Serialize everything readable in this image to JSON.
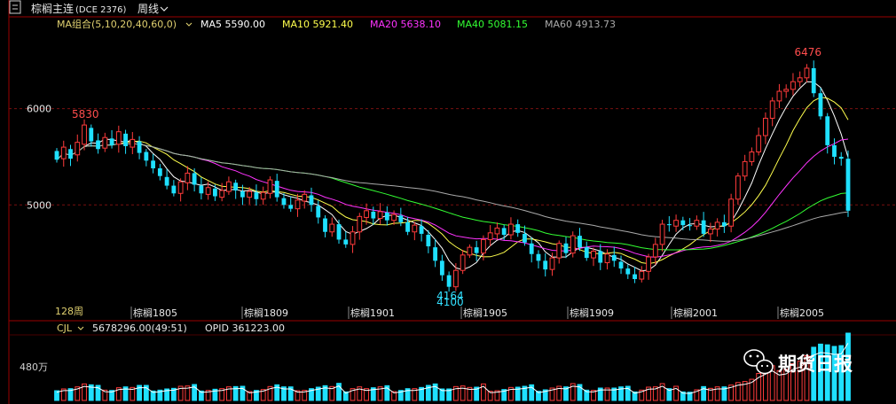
{
  "header": {
    "title": "棕榈主连",
    "code": "(DCE 2376)",
    "period": "周线"
  },
  "ma": {
    "group_label": "MA组合(5,10,20,40,60,0)",
    "ma5": "MA5 5590.00",
    "ma10": "MA10 5921.40",
    "ma20": "MA20 5638.10",
    "ma40": "MA40 5081.15",
    "ma60": "MA60 4913.73"
  },
  "volume": {
    "label": "CJL",
    "value": "5678296.00(49:51)",
    "opid": "OPID 361223.00",
    "axis_label": "480万"
  },
  "watermark": "期货日报",
  "colors": {
    "up": "#ff3b3b",
    "down": "#1fe0ff",
    "ma5": "#ffffff",
    "ma10": "#ffff4d",
    "ma20": "#ff33ff",
    "ma40": "#33ff33",
    "ma60": "#aaaaaa",
    "grid": "#7a1010",
    "axis": "#a00000"
  },
  "chart_data": {
    "type": "candlestick",
    "period_count_label": "128周",
    "y_ticks": [
      6000,
      5000
    ],
    "y_range": [
      4000,
      6760
    ],
    "x_ticks": [
      "棕榈1805",
      "棕榈1809",
      "棕榈1901",
      "棕榈1905",
      "棕榈1909",
      "棕榈2001",
      "棕榈2005"
    ],
    "annotations": [
      {
        "label": "5830",
        "value": 5830
      },
      {
        "label": "4100",
        "value": 4100
      },
      {
        "label": "4164",
        "value": 4164
      },
      {
        "label": "6476",
        "value": 6476
      }
    ],
    "candles": [
      [
        5560,
        5470
      ],
      [
        5480,
        5600
      ],
      [
        5580,
        5480
      ],
      [
        5520,
        5650
      ],
      [
        5630,
        5830
      ],
      [
        5800,
        5660
      ],
      [
        5670,
        5580
      ],
      [
        5590,
        5700
      ],
      [
        5690,
        5620
      ],
      [
        5630,
        5760
      ],
      [
        5740,
        5610
      ],
      [
        5600,
        5680
      ],
      [
        5660,
        5540
      ],
      [
        5550,
        5460
      ],
      [
        5460,
        5380
      ],
      [
        5380,
        5300
      ],
      [
        5290,
        5200
      ],
      [
        5200,
        5120
      ],
      [
        5120,
        5240
      ],
      [
        5230,
        5330
      ],
      [
        5330,
        5210
      ],
      [
        5200,
        5120
      ],
      [
        5110,
        5180
      ],
      [
        5170,
        5090
      ],
      [
        5080,
        5150
      ],
      [
        5140,
        5240
      ],
      [
        5230,
        5150
      ],
      [
        5140,
        5080
      ],
      [
        5080,
        5140
      ],
      [
        5130,
        5060
      ],
      [
        5060,
        5130
      ],
      [
        5120,
        5260
      ],
      [
        5250,
        5080
      ],
      [
        5070,
        5000
      ],
      [
        5000,
        4960
      ],
      [
        4960,
        5050
      ],
      [
        5040,
        5110
      ],
      [
        5100,
        5000
      ],
      [
        4990,
        4870
      ],
      [
        4860,
        4720
      ],
      [
        4720,
        4800
      ],
      [
        4800,
        4640
      ],
      [
        4640,
        4590
      ],
      [
        4590,
        4720
      ],
      [
        4720,
        4880
      ],
      [
        4870,
        4940
      ],
      [
        4930,
        4860
      ],
      [
        4860,
        4930
      ],
      [
        4920,
        4840
      ],
      [
        4840,
        4900
      ],
      [
        4890,
        4820
      ],
      [
        4820,
        4720
      ],
      [
        4720,
        4790
      ],
      [
        4780,
        4700
      ],
      [
        4690,
        4570
      ],
      [
        4560,
        4420
      ],
      [
        4420,
        4270
      ],
      [
        4270,
        4150
      ],
      [
        4150,
        4320
      ],
      [
        4320,
        4480
      ],
      [
        4480,
        4560
      ],
      [
        4560,
        4500
      ],
      [
        4500,
        4640
      ],
      [
        4640,
        4710
      ],
      [
        4700,
        4760
      ],
      [
        4760,
        4690
      ],
      [
        4690,
        4800
      ],
      [
        4800,
        4710
      ],
      [
        4700,
        4610
      ],
      [
        4600,
        4490
      ],
      [
        4490,
        4420
      ],
      [
        4420,
        4330
      ],
      [
        4330,
        4450
      ],
      [
        4450,
        4600
      ],
      [
        4600,
        4500
      ],
      [
        4500,
        4680
      ],
      [
        4680,
        4560
      ],
      [
        4560,
        4450
      ],
      [
        4450,
        4520
      ],
      [
        4520,
        4400
      ],
      [
        4400,
        4490
      ],
      [
        4480,
        4420
      ],
      [
        4410,
        4340
      ],
      [
        4340,
        4280
      ],
      [
        4280,
        4230
      ],
      [
        4230,
        4310
      ],
      [
        4310,
        4460
      ],
      [
        4460,
        4590
      ],
      [
        4590,
        4800
      ],
      [
        4800,
        4790
      ],
      [
        4780,
        4840
      ],
      [
        4840,
        4790
      ],
      [
        4790,
        4780
      ],
      [
        4780,
        4840
      ],
      [
        4840,
        4700
      ],
      [
        4700,
        4750
      ],
      [
        4750,
        4820
      ],
      [
        4820,
        4780
      ],
      [
        4780,
        5060
      ],
      [
        5060,
        5300
      ],
      [
        5300,
        5450
      ],
      [
        5450,
        5550
      ],
      [
        5550,
        5720
      ],
      [
        5720,
        5900
      ],
      [
        5900,
        6080
      ],
      [
        6080,
        6180
      ],
      [
        6180,
        6200
      ],
      [
        6200,
        6280
      ],
      [
        6280,
        6320
      ],
      [
        6320,
        6420
      ],
      [
        6420,
        6160
      ],
      [
        6160,
        5920
      ],
      [
        5920,
        5620
      ],
      [
        5620,
        5500
      ],
      [
        5500,
        5480
      ],
      [
        5480,
        4940
      ]
    ]
  }
}
